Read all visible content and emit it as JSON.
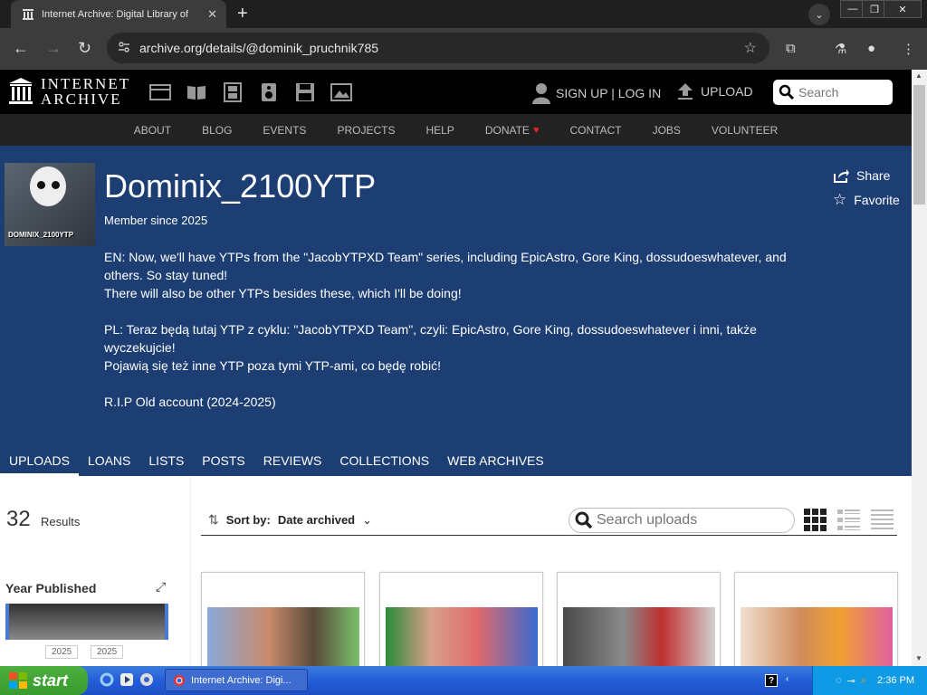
{
  "browser": {
    "tab_title": "Internet Archive: Digital Library of",
    "url": "archive.org/details/@dominik_pruchnik785"
  },
  "ia_header": {
    "logo_line1": "INTERNET",
    "logo_line2": "ARCHIVE",
    "signup": "SIGN UP | LOG IN",
    "upload": "UPLOAD",
    "search_placeholder": "Search"
  },
  "ia_nav": [
    "ABOUT",
    "BLOG",
    "EVENTS",
    "PROJECTS",
    "HELP",
    "DONATE",
    "CONTACT",
    "JOBS",
    "VOLUNTEER"
  ],
  "profile": {
    "name": "Dominix_2100YTP",
    "avatar_text": "DOMINIX_2100YTP",
    "member_since": "Member since 2025",
    "bio_en_1": "EN: Now, we'll have YTPs from the \"JacobYTPXD Team\" series, including EpicAstro, Gore King, dossudoeswhatever, and others. So stay tuned!",
    "bio_en_2": "There will also be other YTPs besides these, which I'll be doing!",
    "bio_pl_1": "PL: Teraz będą tutaj YTP z cyklu: \"JacobYTPXD Team\", czyli: EpicAstro, Gore King, dossudoeswhatever i inni, także wyczekujcie!",
    "bio_pl_2": "Pojawią się też inne YTP poza tymi YTP-ami, co będę robić!",
    "bio_rip": "R.I.P Old account (2024-2025)",
    "share": "Share",
    "favorite": "Favorite"
  },
  "tabs": [
    "UPLOADS",
    "LOANS",
    "LISTS",
    "POSTS",
    "REVIEWS",
    "COLLECTIONS",
    "WEB ARCHIVES"
  ],
  "results": {
    "count": "32",
    "label": "Results",
    "facet_title": "Year Published",
    "year_from": "2025",
    "year_to": "2025",
    "sort_label": "Sort by:",
    "sort_value": "Date archived",
    "search_placeholder": "Search uploads"
  },
  "taskbar": {
    "start": "start",
    "task": "Internet Archive: Digi...",
    "clock": "2:36 PM"
  },
  "colors": {
    "banner": "#1c3e73",
    "ia_black": "#000000",
    "nav_gray": "#222222"
  }
}
